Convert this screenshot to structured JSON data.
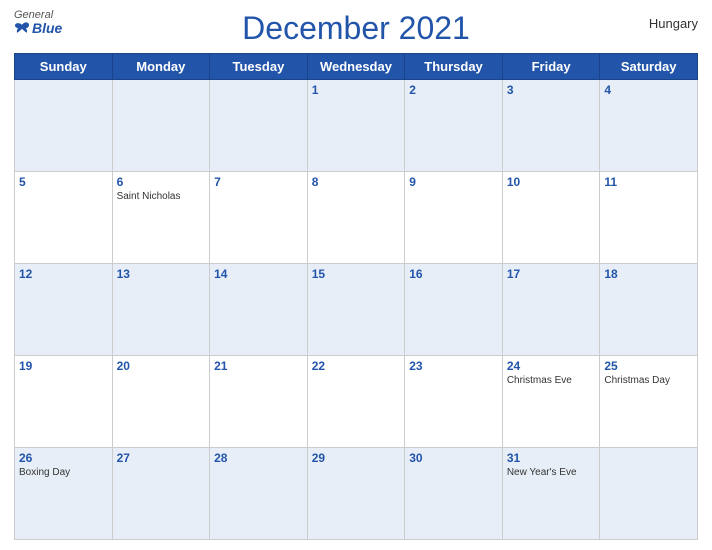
{
  "header": {
    "title": "December 2021",
    "country": "Hungary",
    "logo": {
      "general": "General",
      "blue": "Blue"
    }
  },
  "weekdays": [
    "Sunday",
    "Monday",
    "Tuesday",
    "Wednesday",
    "Thursday",
    "Friday",
    "Saturday"
  ],
  "weeks": [
    [
      {
        "day": "",
        "holiday": ""
      },
      {
        "day": "",
        "holiday": ""
      },
      {
        "day": "",
        "holiday": ""
      },
      {
        "day": "1",
        "holiday": ""
      },
      {
        "day": "2",
        "holiday": ""
      },
      {
        "day": "3",
        "holiday": ""
      },
      {
        "day": "4",
        "holiday": ""
      }
    ],
    [
      {
        "day": "5",
        "holiday": ""
      },
      {
        "day": "6",
        "holiday": "Saint Nicholas"
      },
      {
        "day": "7",
        "holiday": ""
      },
      {
        "day": "8",
        "holiday": ""
      },
      {
        "day": "9",
        "holiday": ""
      },
      {
        "day": "10",
        "holiday": ""
      },
      {
        "day": "11",
        "holiday": ""
      }
    ],
    [
      {
        "day": "12",
        "holiday": ""
      },
      {
        "day": "13",
        "holiday": ""
      },
      {
        "day": "14",
        "holiday": ""
      },
      {
        "day": "15",
        "holiday": ""
      },
      {
        "day": "16",
        "holiday": ""
      },
      {
        "day": "17",
        "holiday": ""
      },
      {
        "day": "18",
        "holiday": ""
      }
    ],
    [
      {
        "day": "19",
        "holiday": ""
      },
      {
        "day": "20",
        "holiday": ""
      },
      {
        "day": "21",
        "holiday": ""
      },
      {
        "day": "22",
        "holiday": ""
      },
      {
        "day": "23",
        "holiday": ""
      },
      {
        "day": "24",
        "holiday": "Christmas Eve"
      },
      {
        "day": "25",
        "holiday": "Christmas Day"
      }
    ],
    [
      {
        "day": "26",
        "holiday": "Boxing Day"
      },
      {
        "day": "27",
        "holiday": ""
      },
      {
        "day": "28",
        "holiday": ""
      },
      {
        "day": "29",
        "holiday": ""
      },
      {
        "day": "30",
        "holiday": ""
      },
      {
        "day": "31",
        "holiday": "New Year's Eve"
      },
      {
        "day": "",
        "holiday": ""
      }
    ]
  ],
  "colors": {
    "blue": "#2255aa",
    "row_even": "#e8eef8",
    "row_odd": "#ffffff"
  }
}
